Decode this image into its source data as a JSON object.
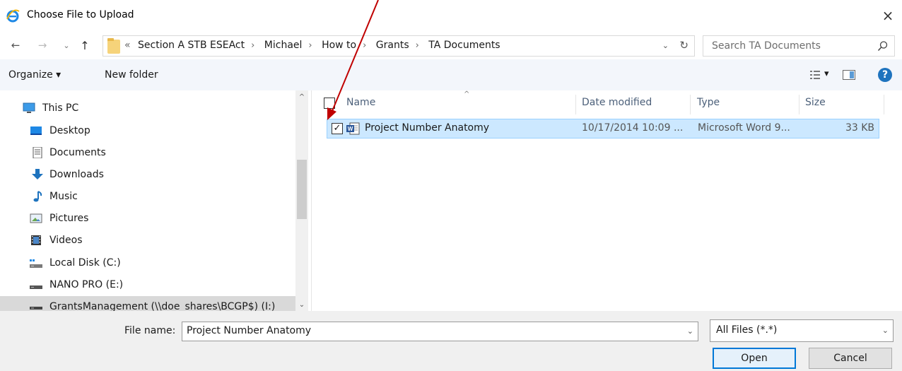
{
  "window": {
    "title": "Choose File to Upload",
    "close_glyph": "×",
    "icon": "internet-explorer-icon"
  },
  "nav": {
    "back_glyph": "←",
    "forward_glyph": "→",
    "recent_glyph": "⌄",
    "up_glyph": "↑",
    "breadcrumb_overflow": "«",
    "breadcrumbs": [
      "Section A STB ESEAct",
      "Michael",
      "How to",
      "Grants",
      "TA Documents"
    ],
    "separator": "›",
    "dropdown_glyph": "⌄",
    "refresh_glyph": "↻",
    "search_placeholder": "Search TA Documents"
  },
  "toolbar": {
    "organize_label": "Organize ▾",
    "new_folder_label": "New folder",
    "view_label": "▾",
    "help_label": "?"
  },
  "sidebar": {
    "items": [
      {
        "label": "This PC",
        "icon": "computer-icon"
      },
      {
        "label": "Desktop",
        "icon": "desktop-icon"
      },
      {
        "label": "Documents",
        "icon": "documents-icon"
      },
      {
        "label": "Downloads",
        "icon": "downloads-icon"
      },
      {
        "label": "Music",
        "icon": "music-icon"
      },
      {
        "label": "Pictures",
        "icon": "pictures-icon"
      },
      {
        "label": "Videos",
        "icon": "videos-icon"
      },
      {
        "label": "Local Disk (C:)",
        "icon": "local-disk-icon"
      },
      {
        "label": "NANO PRO (E:)",
        "icon": "drive-icon"
      },
      {
        "label": "GrantsManagement (\\\\doe_shares\\BCGP$) (I:)",
        "icon": "network-drive-icon"
      }
    ],
    "scroll_up_glyph": "^",
    "scroll_down_glyph": "⌄"
  },
  "file_list": {
    "sort_glyph": "^",
    "columns": {
      "name": "Name",
      "date": "Date modified",
      "type": "Type",
      "size": "Size"
    },
    "rows": [
      {
        "checked": "✓",
        "name": "Project Number Anatomy",
        "date": "10/17/2014 10:09 ...",
        "type": "Microsoft Word 9...",
        "size": "33 KB"
      }
    ]
  },
  "bottom": {
    "file_name_label": "File name:",
    "file_name_value": "Project Number Anatomy",
    "dropdown_glyph": "⌄",
    "filter_value": "All Files (*.*)",
    "open_label": "Open",
    "cancel_label": "Cancel"
  },
  "colors": {
    "selection": "#cce8ff",
    "accent": "#0078d7",
    "annotation_arrow": "#c00000"
  }
}
